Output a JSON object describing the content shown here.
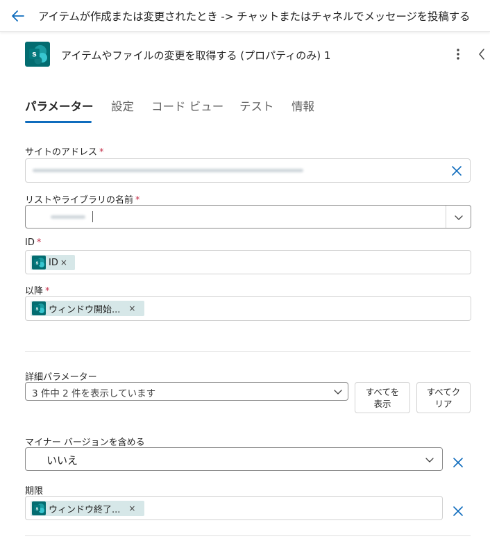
{
  "colors": {
    "accent": "#0f6cbd",
    "sharepoint": "#036c70",
    "required": "#c4314b",
    "token_bg": "#d6e7e8"
  },
  "topbar": {
    "back_icon": "arrow-left-icon",
    "title": "アイテムが作成または変更されたとき -> チャットまたはチャネルでメッセージを投稿する"
  },
  "action": {
    "logo_icon": "sharepoint-logo-icon",
    "logo_letter": "s",
    "title": "アイテムやファイルの変更を取得する (プロパティのみ) 1",
    "more_icon": "more-vertical-icon",
    "collapse_icon": "chevron-left-icon"
  },
  "tabs": [
    {
      "label": "パラメーター",
      "active": true
    },
    {
      "label": "設定"
    },
    {
      "label": "コード ビュー"
    },
    {
      "label": "テスト"
    },
    {
      "label": "情報"
    }
  ],
  "fields": {
    "site_address": {
      "label": "サイトのアドレス",
      "required": "*",
      "clear_icon": "close-icon"
    },
    "list_name": {
      "label": "リストやライブラリの名前",
      "required": "*",
      "dropdown_icon": "chevron-down-icon"
    },
    "id": {
      "label": "ID",
      "required": "*",
      "token": {
        "text": "ID",
        "remove": "×"
      }
    },
    "since": {
      "label": "以降",
      "required": "*",
      "token": {
        "text": "ウィンドウ開始...",
        "remove": "×"
      }
    }
  },
  "advanced": {
    "label": "詳細パラメーター",
    "summary": "3 件中 2 件を表示しています",
    "show_all": "すべてを表示",
    "clear_all": "すべてクリア",
    "show_all_line1": "すべてを",
    "show_all_line2": "表示",
    "clear_all_line1": "すべてク",
    "clear_all_line2": "リア"
  },
  "minor_version": {
    "label": "マイナー バージョンを含める",
    "value": "いいえ",
    "clear_icon": "close-icon"
  },
  "until": {
    "label": "期限",
    "token": {
      "text": "ウィンドウ終了...",
      "remove": "×"
    },
    "clear_icon": "close-icon"
  }
}
